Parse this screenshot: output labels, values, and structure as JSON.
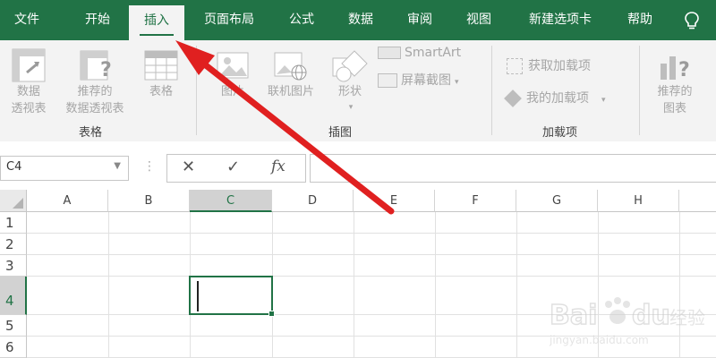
{
  "tabs": [
    {
      "label": "文件",
      "active": false
    },
    {
      "label": "开始",
      "active": false
    },
    {
      "label": "插入",
      "active": true
    },
    {
      "label": "页面布局",
      "active": false
    },
    {
      "label": "公式",
      "active": false
    },
    {
      "label": "数据",
      "active": false
    },
    {
      "label": "审阅",
      "active": false
    },
    {
      "label": "视图",
      "active": false
    },
    {
      "label": "新建选项卡",
      "active": false
    },
    {
      "label": "帮助",
      "active": false
    }
  ],
  "ribbon": {
    "groups": {
      "tables": "表格",
      "illustrations": "插图",
      "addins": "加载项"
    },
    "tables": {
      "pivot_line1": "数据",
      "pivot_line2": "透视表",
      "rec_pivot_line1": "推荐的",
      "rec_pivot_line2": "数据透视表",
      "table": "表格"
    },
    "illustrations": {
      "pictures": "图片",
      "online_pictures": "联机图片",
      "shapes": "形状",
      "smartart": "SmartArt",
      "screenshot": "屏幕截图"
    },
    "addins": {
      "get": "获取加载项",
      "my": "我的加载项"
    },
    "charts": {
      "rec_line1": "推荐的",
      "rec_line2": "图表"
    }
  },
  "formula_bar": {
    "name_box": "C4",
    "cancel": "✕",
    "enter": "✓",
    "fx": "fx",
    "value": ""
  },
  "grid": {
    "columns": [
      "A",
      "B",
      "C",
      "D",
      "E",
      "F",
      "G",
      "H"
    ],
    "rows": [
      "1",
      "2",
      "3",
      "4",
      "5",
      "6"
    ],
    "selected_column": "C",
    "selected_row": "4"
  },
  "colors": {
    "accent": "#217346",
    "arrow": "#e02020"
  }
}
